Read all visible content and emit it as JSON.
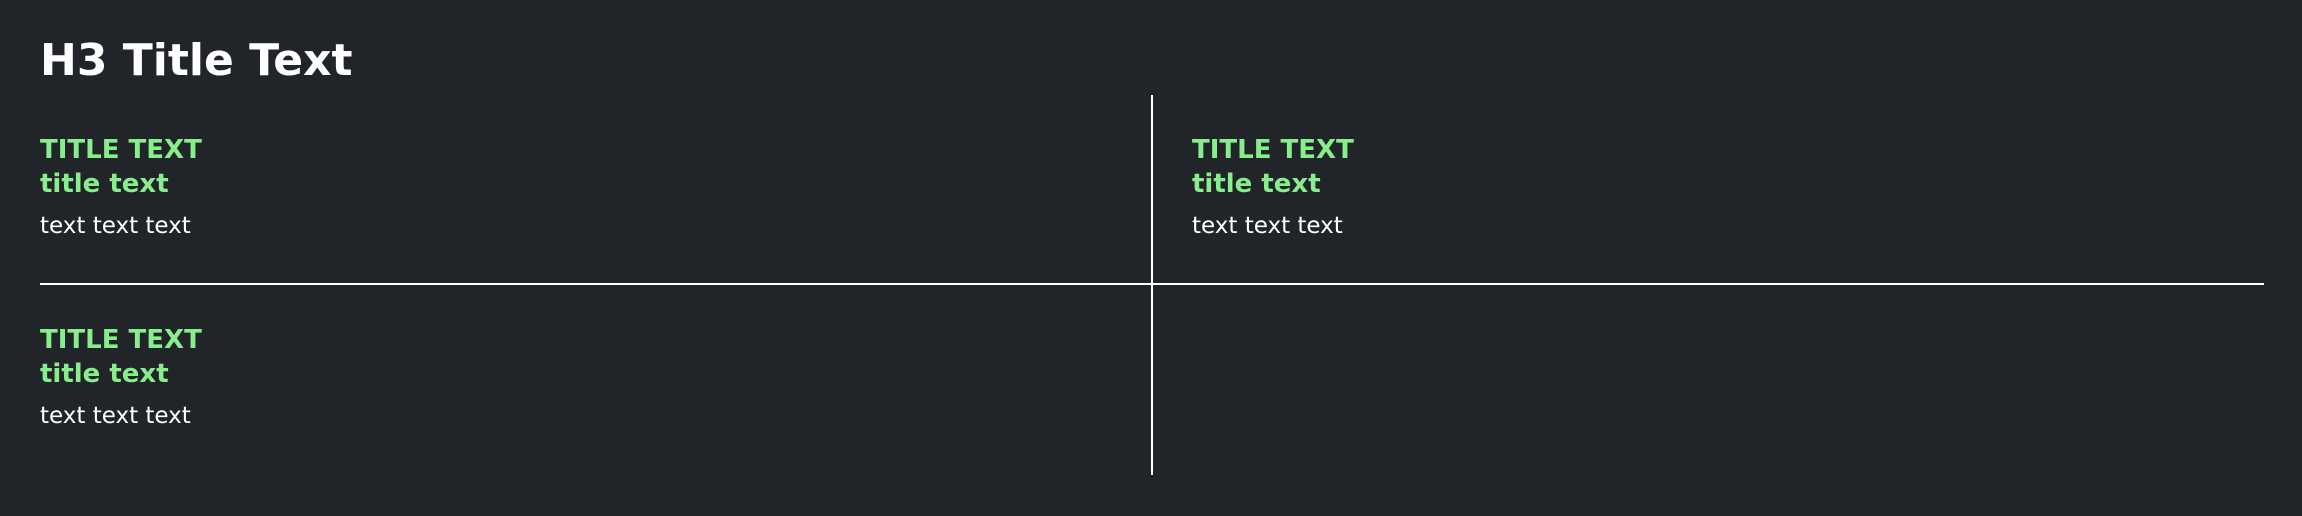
{
  "header": {
    "title": "H3 Title Text"
  },
  "cells": [
    {
      "title_upper": "TITLE TEXT",
      "title_lower": "title text",
      "text": "text text text"
    },
    {
      "title_upper": "TITLE TEXT",
      "title_lower": "title text",
      "text": "text text text"
    },
    {
      "title_upper": "TITLE TEXT",
      "title_lower": "title text",
      "text": "text text text"
    }
  ],
  "colors": {
    "background": "#212429",
    "accent_green": "#86ee8a",
    "text": "#ffffff",
    "divider": "#ffffff"
  }
}
